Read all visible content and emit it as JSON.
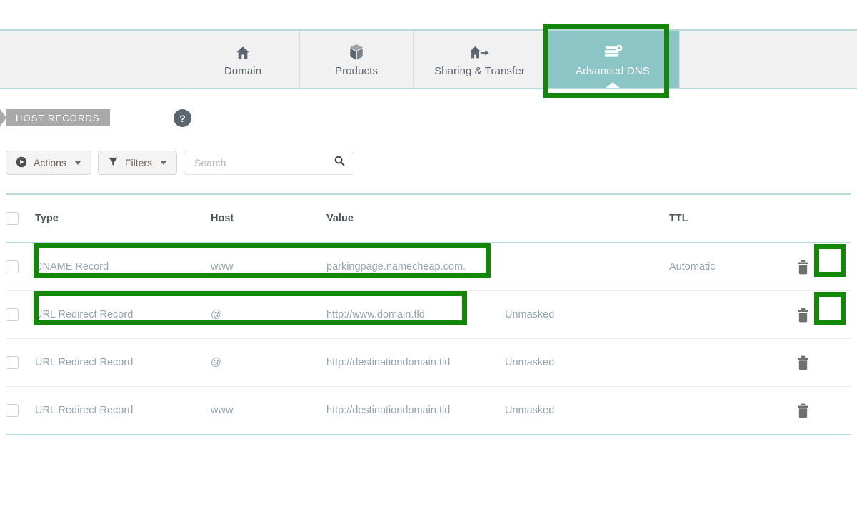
{
  "tabs": {
    "items": [
      {
        "label": "Domain",
        "icon": "house-icon",
        "active": false
      },
      {
        "label": "Products",
        "icon": "box-icon",
        "active": false
      },
      {
        "label": "Sharing & Transfer",
        "icon": "house-arrow-icon",
        "active": false
      },
      {
        "label": "Advanced DNS",
        "icon": "server-gear-icon",
        "active": true
      }
    ]
  },
  "section": {
    "ribbon_label": "HOST RECORDS",
    "help_label": "?"
  },
  "toolbar": {
    "actions_label": "Actions",
    "actions_icon": "play-circle-icon",
    "filters_label": "Filters",
    "filters_icon": "funnel-icon",
    "search_placeholder": "Search",
    "search_value": "",
    "search_icon": "magnifier-icon"
  },
  "table": {
    "headers": {
      "type": "Type",
      "host": "Host",
      "value": "Value",
      "extra": "",
      "ttl": "TTL"
    },
    "rows": [
      {
        "type": "CNAME Record",
        "host": "www",
        "value": "parkingpage.namecheap.com.",
        "extra": "",
        "ttl": "Automatic",
        "delete_icon": "trash-icon"
      },
      {
        "type": "URL Redirect Record",
        "host": "@",
        "value": "http://www.domain.tld",
        "extra": "Unmasked",
        "ttl": "",
        "delete_icon": "trash-icon"
      },
      {
        "type": "URL Redirect Record",
        "host": "@",
        "value": "http://destinationdomain.tld",
        "extra": "Unmasked",
        "ttl": "",
        "delete_icon": "trash-icon"
      },
      {
        "type": "URL Redirect Record",
        "host": "www",
        "value": "http://destinationdomain.tld",
        "extra": "Unmasked",
        "ttl": "",
        "delete_icon": "trash-icon"
      }
    ]
  },
  "colors": {
    "accent_teal": "#8cc5c6",
    "rule_teal": "#b6dadb",
    "highlight_green": "#138808",
    "ribbon_gray": "#a9a9a9",
    "cell_text": "#93a5b1"
  }
}
